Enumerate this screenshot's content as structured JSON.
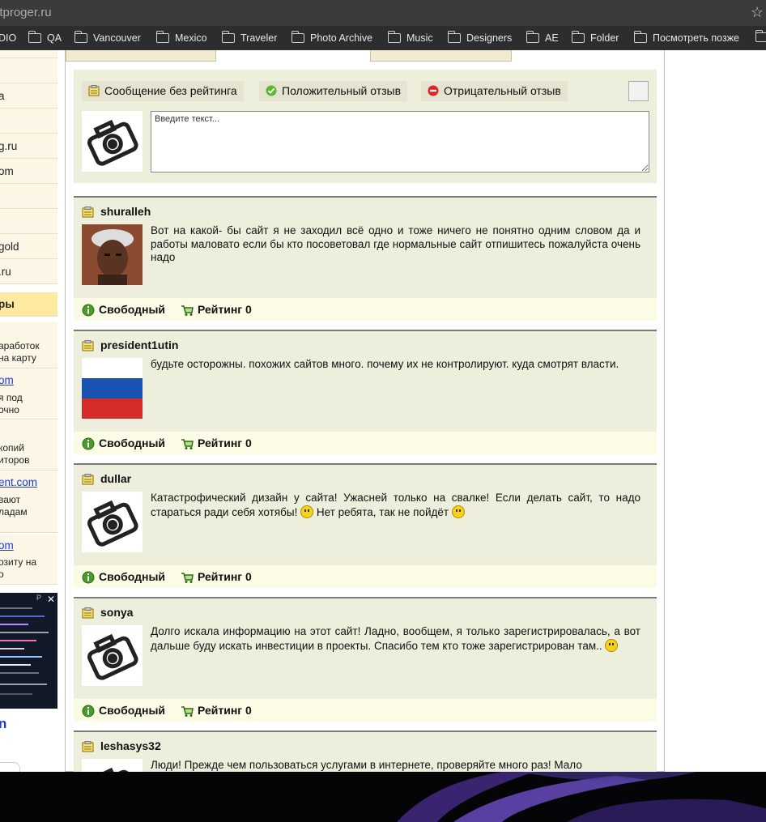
{
  "browser": {
    "url": "itproger.ru",
    "bookmarks": [
      "DIO",
      "QA",
      "Vancouver",
      "Mexico",
      "Traveler",
      "Photo Archive",
      "Music",
      "Designers",
      "AE",
      "Folder",
      "Посмотреть позже"
    ]
  },
  "sidebar": {
    "items": [
      "a",
      "g.ru",
      "om",
      "gold",
      ".ru"
    ],
    "highlight": "ры",
    "snippets": [
      {
        "link": "",
        "lines": [
          "аработок",
          "на карту"
        ]
      },
      {
        "link": "om",
        "lines": [
          "я под",
          "очно"
        ]
      },
      {
        "link": "",
        "lines": [
          "копий",
          "иторов"
        ]
      },
      {
        "link": "ent.com",
        "lines": [
          "вают",
          "ладам"
        ]
      },
      {
        "link": "om",
        "lines": [
          "озиту на",
          "о"
        ]
      }
    ],
    "bottom_link": "n",
    "ad_letter": "P",
    "ad_close": "✕"
  },
  "composer": {
    "options": [
      "Сообщение без рейтинга",
      "Положительный отзыв",
      "Отрицательный отзыв"
    ],
    "placeholder": "Введите текст..."
  },
  "posts": [
    {
      "author": "shuralleh",
      "text": "Вот на какой- бы сайт я не заходил всё одно и тоже ничего не понятно одним словом да и работы маловато если бы кто посоветовал где нормальные сайт отпишитесь пожалуйста очень надо",
      "status": "Свободный",
      "rating": "Рейтинг 0"
    },
    {
      "author": "president1utin",
      "text": "будьте осторожны. похожих сайтов много. почему их не контролируют. куда смотрят власти.",
      "status": "Свободный",
      "rating": "Рейтинг 0"
    },
    {
      "author": "dullar",
      "text": "Катастрофический дизайн у сайта! Ужасней только на свалке! Если делать сайт, то надо стараться ради себя хотябы!",
      "text2": "Нет ребята, так не пойдёт",
      "status": "Свободный",
      "rating": "Рейтинг 0"
    },
    {
      "author": "sonya",
      "text": "Долго искала информацию на этот сайт! Ладно, вообщем, я только зарегистрировалась, а вот дальше буду искать инвестиции в проекты. Спасибо тем кто тоже зарегистрирован там..",
      "status": "Свободный",
      "rating": "Рейтинг 0"
    },
    {
      "author": "leshasys32",
      "text": "Люди! Прежде чем пользоваться услугами в интернете, проверяйте много раз! Мало"
    }
  ],
  "colors": {
    "accent_yellow": "#fde9a0",
    "post_bg": "#eeeedd",
    "link": "#1a3ad6"
  }
}
